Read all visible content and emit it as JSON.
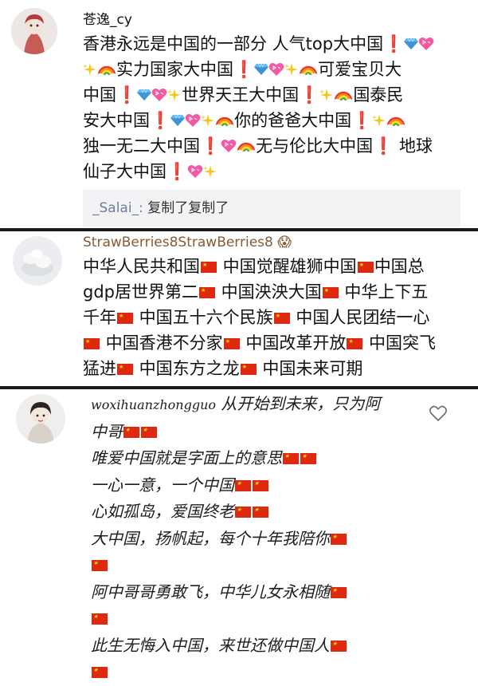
{
  "comments": [
    {
      "username": "苍逸_cy",
      "lines": [
        [
          [
            "t",
            "香港永远是中国的一部分 人气top大中国"
          ],
          [
            "e",
            "excl"
          ],
          [
            "e",
            "gem"
          ],
          [
            "e",
            "heart"
          ]
        ],
        [
          [
            "e",
            "spark"
          ],
          [
            "e",
            "rainbow"
          ],
          [
            "t",
            "实力国家大中国"
          ],
          [
            "e",
            "excl"
          ],
          [
            "e",
            "gem"
          ],
          [
            "e",
            "heart"
          ],
          [
            "e",
            "spark"
          ],
          [
            "e",
            "rainbow"
          ],
          [
            "t",
            "可爱宝贝大"
          ]
        ],
        [
          [
            "t",
            "中国"
          ],
          [
            "e",
            "excl"
          ],
          [
            "e",
            "gem"
          ],
          [
            "e",
            "heart"
          ],
          [
            "e",
            "spark"
          ],
          [
            "t",
            "世界天王大中国"
          ],
          [
            "e",
            "excl"
          ],
          [
            "e",
            "spark"
          ],
          [
            "e",
            "rainbow"
          ],
          [
            "t",
            "国泰民"
          ]
        ],
        [
          [
            "t",
            "安大中国"
          ],
          [
            "e",
            "excl"
          ],
          [
            "e",
            "gem"
          ],
          [
            "e",
            "heart"
          ],
          [
            "e",
            "spark"
          ],
          [
            "e",
            "rainbow"
          ],
          [
            "t",
            "你的爸爸大中国"
          ],
          [
            "e",
            "excl"
          ],
          [
            "e",
            "spark"
          ],
          [
            "e",
            "rainbow"
          ]
        ],
        [
          [
            "t",
            "独一无二大中国"
          ],
          [
            "e",
            "excl"
          ],
          [
            "e",
            "heart"
          ],
          [
            "e",
            "rainbow"
          ],
          [
            "t",
            "无与伦比大中国"
          ],
          [
            "e",
            "excl"
          ],
          [
            "t",
            " 地球"
          ]
        ],
        [
          [
            "t",
            "仙子大中国"
          ],
          [
            "e",
            "excl"
          ],
          [
            "e",
            "heart"
          ],
          [
            "e",
            "spark"
          ]
        ]
      ],
      "reply": {
        "name": "_Salai_:",
        "text": " 复制了复制了"
      }
    },
    {
      "username": "StrawBerries8StrawBerries8",
      "username_emoji": "😱",
      "lines": [
        [
          [
            "t",
            "中华人民共和国"
          ],
          [
            "e",
            "flag"
          ],
          [
            "t",
            " 中国觉醒雄狮中国"
          ],
          [
            "e",
            "flag"
          ],
          [
            "t",
            "中国总"
          ]
        ],
        [
          [
            "t",
            "gdp居世界第二"
          ],
          [
            "e",
            "flag"
          ],
          [
            "t",
            " 中国泱泱大国"
          ],
          [
            "e",
            "flag"
          ],
          [
            "t",
            " 中华上下五"
          ]
        ],
        [
          [
            "t",
            "千年"
          ],
          [
            "e",
            "flag"
          ],
          [
            "t",
            " 中国五十六个民族"
          ],
          [
            "e",
            "flag"
          ],
          [
            "t",
            " 中国人民团结一心"
          ]
        ],
        [
          [
            "e",
            "flag"
          ],
          [
            "t",
            " 中国香港不分家"
          ],
          [
            "e",
            "flag"
          ],
          [
            "t",
            " 中国改革开放"
          ],
          [
            "e",
            "flag"
          ],
          [
            "t",
            " 中国突飞"
          ]
        ],
        [
          [
            "t",
            "猛进"
          ],
          [
            "e",
            "flag"
          ],
          [
            "t",
            " 中国东方之龙"
          ],
          [
            "e",
            "flag"
          ],
          [
            "t",
            " 中国未来可期"
          ]
        ]
      ]
    },
    {
      "username": "woxihuanzhongguo",
      "lines": [
        [
          [
            "t",
            " 从开始到未来，只为阿"
          ]
        ],
        [
          [
            "t",
            "中哥"
          ],
          [
            "e",
            "flag"
          ],
          [
            "e",
            "flag"
          ]
        ],
        [
          [
            "t",
            "唯爱中国就是字面上的意思"
          ],
          [
            "e",
            "flag"
          ],
          [
            "e",
            "flag"
          ]
        ],
        [
          [
            "t",
            "一心一意，一个中国"
          ],
          [
            "e",
            "flag"
          ],
          [
            "e",
            "flag"
          ]
        ],
        [
          [
            "t",
            "心如孤岛，爱国终老"
          ],
          [
            "e",
            "flag"
          ],
          [
            "e",
            "flag"
          ]
        ],
        [
          [
            "t",
            "大中国，扬帆起，每个十年我陪你"
          ],
          [
            "e",
            "flag"
          ]
        ],
        [
          [
            "e",
            "flag"
          ]
        ],
        [
          [
            "t",
            "阿中哥哥勇敢飞，中华儿女永相随"
          ],
          [
            "e",
            "flag"
          ]
        ],
        [
          [
            "e",
            "flag"
          ]
        ],
        [
          [
            "t",
            "此生无悔入中国，来世还做中国人"
          ],
          [
            "e",
            "flag"
          ]
        ],
        [
          [
            "e",
            "flag"
          ]
        ]
      ]
    }
  ],
  "colors": {
    "username": "#6a7e9e",
    "flag": "#de2910",
    "exclaim": "#e0241b",
    "divider": "#1a1a1a",
    "reply_bg": "#f3f3f5"
  }
}
